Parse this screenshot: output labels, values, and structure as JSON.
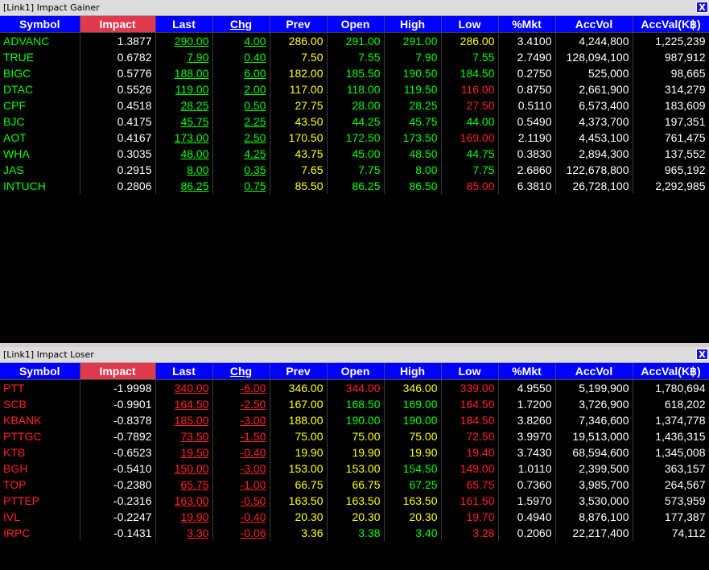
{
  "columns": [
    "Symbol",
    "Impact",
    "Last",
    "Chg",
    "Prev",
    "Open",
    "High",
    "Low",
    "%Mkt",
    "AccVol",
    "AccVal(K฿)"
  ],
  "colors": {
    "up": "#00ff00",
    "down": "#ff2020",
    "unchanged": "#ffff00",
    "neutral": "#ffffff",
    "header": "#0000ff",
    "sorted_header": "#e0384c"
  },
  "gainer": {
    "title": "[Link1] Impact Gainer",
    "close_label": "X",
    "rows": [
      {
        "c": [
          "ADVANC",
          "1.3877",
          "290.00",
          "4.00",
          "286.00",
          "291.00",
          "291.00",
          "286.00",
          "3.4100",
          "4,244,800",
          "1,225,239"
        ],
        "k": [
          "g",
          "w",
          "g",
          "g",
          "y",
          "g",
          "g",
          "y",
          "w",
          "w",
          "w"
        ]
      },
      {
        "c": [
          "TRUE",
          "0.6782",
          "7.90",
          "0.40",
          "7.50",
          "7.55",
          "7.90",
          "7.55",
          "2.7490",
          "128,094,100",
          "987,912"
        ],
        "k": [
          "g",
          "w",
          "g",
          "g",
          "y",
          "g",
          "g",
          "g",
          "w",
          "w",
          "w"
        ]
      },
      {
        "c": [
          "BIGC",
          "0.5776",
          "188.00",
          "6.00",
          "182.00",
          "185.50",
          "190.50",
          "184.50",
          "0.2750",
          "525,000",
          "98,665"
        ],
        "k": [
          "g",
          "w",
          "g",
          "g",
          "y",
          "g",
          "g",
          "g",
          "w",
          "w",
          "w"
        ]
      },
      {
        "c": [
          "DTAC",
          "0.5526",
          "119.00",
          "2.00",
          "117.00",
          "118.00",
          "119.50",
          "116.00",
          "0.8750",
          "2,661,900",
          "314,279"
        ],
        "k": [
          "g",
          "w",
          "g",
          "g",
          "y",
          "g",
          "g",
          "r",
          "w",
          "w",
          "w"
        ]
      },
      {
        "c": [
          "CPF",
          "0.4518",
          "28.25",
          "0.50",
          "27.75",
          "28.00",
          "28.25",
          "27.50",
          "0.5110",
          "6,573,400",
          "183,609"
        ],
        "k": [
          "g",
          "w",
          "g",
          "g",
          "y",
          "g",
          "g",
          "r",
          "w",
          "w",
          "w"
        ]
      },
      {
        "c": [
          "BJC",
          "0.4175",
          "45.75",
          "2.25",
          "43.50",
          "44.25",
          "45.75",
          "44.00",
          "0.5490",
          "4,373,700",
          "197,351"
        ],
        "k": [
          "g",
          "w",
          "g",
          "g",
          "y",
          "g",
          "g",
          "g",
          "w",
          "w",
          "w"
        ]
      },
      {
        "c": [
          "AOT",
          "0.4167",
          "173.00",
          "2.50",
          "170.50",
          "172.50",
          "173.50",
          "169.00",
          "2.1190",
          "4,453,100",
          "761,475"
        ],
        "k": [
          "g",
          "w",
          "g",
          "g",
          "y",
          "g",
          "g",
          "r",
          "w",
          "w",
          "w"
        ]
      },
      {
        "c": [
          "WHA",
          "0.3035",
          "48.00",
          "4.25",
          "43.75",
          "45.00",
          "48.50",
          "44.75",
          "0.3830",
          "2,894,300",
          "137,552"
        ],
        "k": [
          "g",
          "w",
          "g",
          "g",
          "y",
          "g",
          "g",
          "g",
          "w",
          "w",
          "w"
        ]
      },
      {
        "c": [
          "JAS",
          "0.2915",
          "8.00",
          "0.35",
          "7.65",
          "7.75",
          "8.00",
          "7.75",
          "2.6860",
          "122,678,800",
          "965,192"
        ],
        "k": [
          "g",
          "w",
          "g",
          "g",
          "y",
          "g",
          "g",
          "g",
          "w",
          "w",
          "w"
        ]
      },
      {
        "c": [
          "INTUCH",
          "0.2806",
          "86.25",
          "0.75",
          "85.50",
          "86.25",
          "86.50",
          "85.00",
          "6.3810",
          "26,728,100",
          "2,292,985"
        ],
        "k": [
          "g",
          "w",
          "g",
          "g",
          "y",
          "g",
          "g",
          "r",
          "w",
          "w",
          "w"
        ]
      }
    ]
  },
  "loser": {
    "title": "[Link1] Impact Loser",
    "close_label": "X",
    "rows": [
      {
        "c": [
          "PTT",
          "-1.9998",
          "340.00",
          "-6.00",
          "346.00",
          "344.00",
          "346.00",
          "339.00",
          "4.9550",
          "5,199,900",
          "1,780,694"
        ],
        "k": [
          "r",
          "w",
          "r",
          "r",
          "y",
          "r",
          "y",
          "r",
          "w",
          "w",
          "w"
        ]
      },
      {
        "c": [
          "SCB",
          "-0.9901",
          "164.50",
          "-2.50",
          "167.00",
          "168.50",
          "169.00",
          "164.50",
          "1.7200",
          "3,726,900",
          "618,202"
        ],
        "k": [
          "r",
          "w",
          "r",
          "r",
          "y",
          "g",
          "g",
          "r",
          "w",
          "w",
          "w"
        ]
      },
      {
        "c": [
          "KBANK",
          "-0.8378",
          "185.00",
          "-3.00",
          "188.00",
          "190.00",
          "190.00",
          "184.50",
          "3.8260",
          "7,346,600",
          "1,374,778"
        ],
        "k": [
          "r",
          "w",
          "r",
          "r",
          "y",
          "g",
          "g",
          "r",
          "w",
          "w",
          "w"
        ]
      },
      {
        "c": [
          "PTTGC",
          "-0.7892",
          "73.50",
          "-1.50",
          "75.00",
          "75.00",
          "75.00",
          "72.50",
          "3.9970",
          "19,513,000",
          "1,436,315"
        ],
        "k": [
          "r",
          "w",
          "r",
          "r",
          "y",
          "y",
          "y",
          "r",
          "w",
          "w",
          "w"
        ]
      },
      {
        "c": [
          "KTB",
          "-0.6523",
          "19.50",
          "-0.40",
          "19.90",
          "19.90",
          "19.90",
          "19.40",
          "3.7430",
          "68,594,600",
          "1,345,008"
        ],
        "k": [
          "r",
          "w",
          "r",
          "r",
          "y",
          "y",
          "y",
          "r",
          "w",
          "w",
          "w"
        ]
      },
      {
        "c": [
          "BGH",
          "-0.5410",
          "150.00",
          "-3.00",
          "153.00",
          "153.00",
          "154.50",
          "149.00",
          "1.0110",
          "2,399,500",
          "363,157"
        ],
        "k": [
          "r",
          "w",
          "r",
          "r",
          "y",
          "y",
          "g",
          "r",
          "w",
          "w",
          "w"
        ]
      },
      {
        "c": [
          "TOP",
          "-0.2380",
          "65.75",
          "-1.00",
          "66.75",
          "66.75",
          "67.25",
          "65.75",
          "0.7360",
          "3,985,700",
          "264,567"
        ],
        "k": [
          "r",
          "w",
          "r",
          "r",
          "y",
          "y",
          "g",
          "r",
          "w",
          "w",
          "w"
        ]
      },
      {
        "c": [
          "PTTEP",
          "-0.2316",
          "163.00",
          "-0.50",
          "163.50",
          "163.50",
          "163.50",
          "161.50",
          "1.5970",
          "3,530,000",
          "573,959"
        ],
        "k": [
          "r",
          "w",
          "r",
          "r",
          "y",
          "y",
          "y",
          "r",
          "w",
          "w",
          "w"
        ]
      },
      {
        "c": [
          "IVL",
          "-0.2247",
          "19.90",
          "-0.40",
          "20.30",
          "20.30",
          "20.30",
          "19.70",
          "0.4940",
          "8,876,100",
          "177,387"
        ],
        "k": [
          "r",
          "w",
          "r",
          "r",
          "y",
          "y",
          "y",
          "r",
          "w",
          "w",
          "w"
        ]
      },
      {
        "c": [
          "IRPC",
          "-0.1431",
          "3.30",
          "-0.06",
          "3.36",
          "3.38",
          "3.40",
          "3.28",
          "0.2060",
          "22,217,400",
          "74,112"
        ],
        "k": [
          "r",
          "w",
          "r",
          "r",
          "y",
          "g",
          "g",
          "r",
          "w",
          "w",
          "w"
        ]
      }
    ]
  }
}
